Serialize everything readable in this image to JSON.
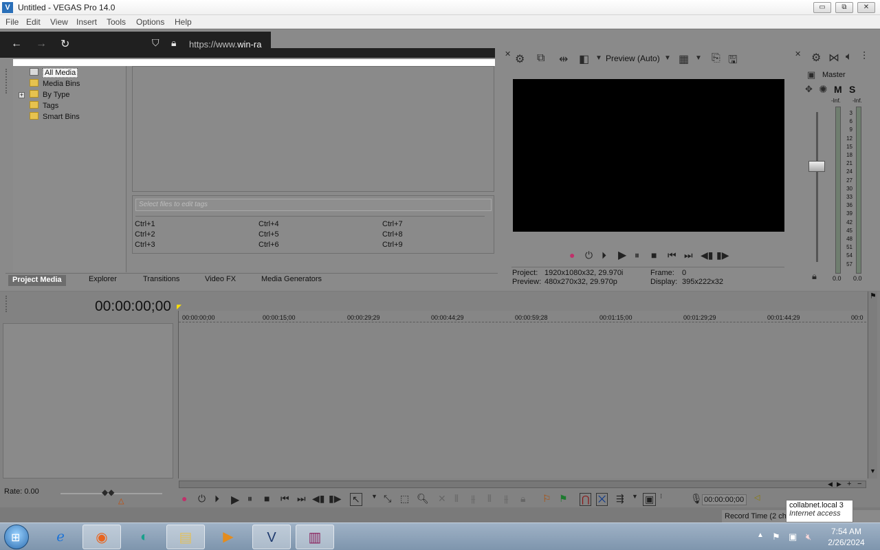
{
  "window": {
    "title": "Untitled - VEGAS Pro 14.0",
    "minimize": "▭",
    "maximize": "⧉",
    "close": "✕"
  },
  "menu": [
    "File",
    "Edit",
    "View",
    "Insert",
    "Tools",
    "Options",
    "Help"
  ],
  "browser_overlay": {
    "url_prefix": "https://www.",
    "url_host": "win-ra"
  },
  "project_media": {
    "tree": [
      {
        "label": "All Media",
        "selected": true
      },
      {
        "label": "Media Bins"
      },
      {
        "label": "By Type",
        "expandable": true
      },
      {
        "label": "Tags"
      },
      {
        "label": "Smart Bins"
      }
    ],
    "expander": "+",
    "tags_placeholder": "Select files to edit tags",
    "shortcuts": [
      "Ctrl+1",
      "Ctrl+2",
      "Ctrl+3",
      "Ctrl+4",
      "Ctrl+5",
      "Ctrl+6",
      "Ctrl+7",
      "Ctrl+8",
      "Ctrl+9"
    ]
  },
  "tabs": [
    "Project Media",
    "Explorer",
    "Transitions",
    "Video FX",
    "Media Generators"
  ],
  "preview": {
    "mode": "Preview (Auto)",
    "project_label": "Project:",
    "project_value": "1920x1080x32, 29.970i",
    "preview_label": "Preview:",
    "preview_value": "480x270x32, 29.970p",
    "frame_label": "Frame:",
    "frame_value": "0",
    "display_label": "Display:",
    "display_value": "395x222x32"
  },
  "master": {
    "label": "Master",
    "m": "M",
    "s": "S",
    "inf_left": "-Inf.",
    "inf_right": "-Inf.",
    "scale": [
      "3",
      "6",
      "9",
      "12",
      "15",
      "18",
      "21",
      "24",
      "27",
      "30",
      "33",
      "36",
      "39",
      "42",
      "45",
      "48",
      "51",
      "54",
      "57"
    ],
    "level_left": "0.0",
    "level_right": "0.0"
  },
  "timeline": {
    "cursor_time": "00:00:00;00",
    "ruler": [
      "00:00:00;00",
      "00:00:15;00",
      "00:00:29;29",
      "00:00:44;29",
      "00:00:59;28",
      "00:01:15;00",
      "00:01:29;29",
      "00:01:44;29",
      "00:0"
    ],
    "rate": "Rate: 0.00",
    "end_time": "00:00:00;00",
    "record_status": "Record Time (2 cha"
  },
  "tooltip": {
    "title": "collabnet.local",
    "count": "3",
    "subtitle": "Internet access"
  },
  "taskbar": {
    "time": "7:54 AM",
    "date": "2/26/2024",
    "apps": [
      "internet-explorer",
      "firefox",
      "chat-app",
      "file-explorer",
      "media-player",
      "vegas-pro",
      "winrar"
    ]
  }
}
